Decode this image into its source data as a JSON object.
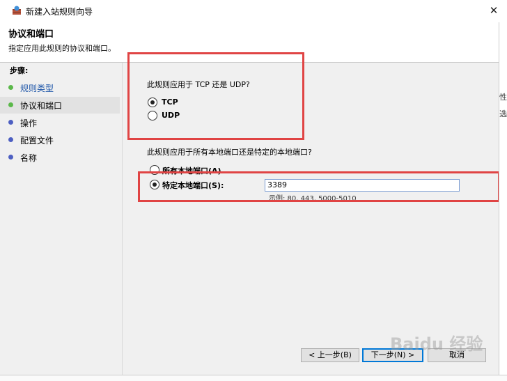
{
  "window": {
    "title": "新建入站规则向导",
    "close_glyph": "✕"
  },
  "header": {
    "title": "协议和端口",
    "subtitle": "指定应用此规则的协议和端口。"
  },
  "steps": {
    "label": "步骤:",
    "items": [
      {
        "label": "规则类型",
        "state": "done"
      },
      {
        "label": "协议和端口",
        "state": "current"
      },
      {
        "label": "操作",
        "state": "pending"
      },
      {
        "label": "配置文件",
        "state": "pending"
      },
      {
        "label": "名称",
        "state": "pending"
      }
    ]
  },
  "protocol": {
    "question": "此规则应用于 TCP 还是 UDP?",
    "options": [
      {
        "label": "TCP",
        "selected": true
      },
      {
        "label": "UDP",
        "selected": false
      }
    ]
  },
  "ports": {
    "question": "此规则应用于所有本地端口还是特定的本地端口?",
    "options": [
      {
        "label": "所有本地端口(A)",
        "selected": false
      },
      {
        "label": "特定本地端口(S):",
        "selected": true
      }
    ],
    "value": "3389",
    "example": "示例: 80, 443, 5000-5010"
  },
  "buttons": {
    "back": "< 上一步(B)",
    "next": "下一步(N) >",
    "cancel": "取消"
  },
  "background_window": {
    "lines": [
      "性",
      "选"
    ]
  },
  "watermark": "Baidu 经验",
  "colors": {
    "step_done": "#5bb84a",
    "step_pending": "#4d5fc2",
    "highlight": "#e04444"
  }
}
